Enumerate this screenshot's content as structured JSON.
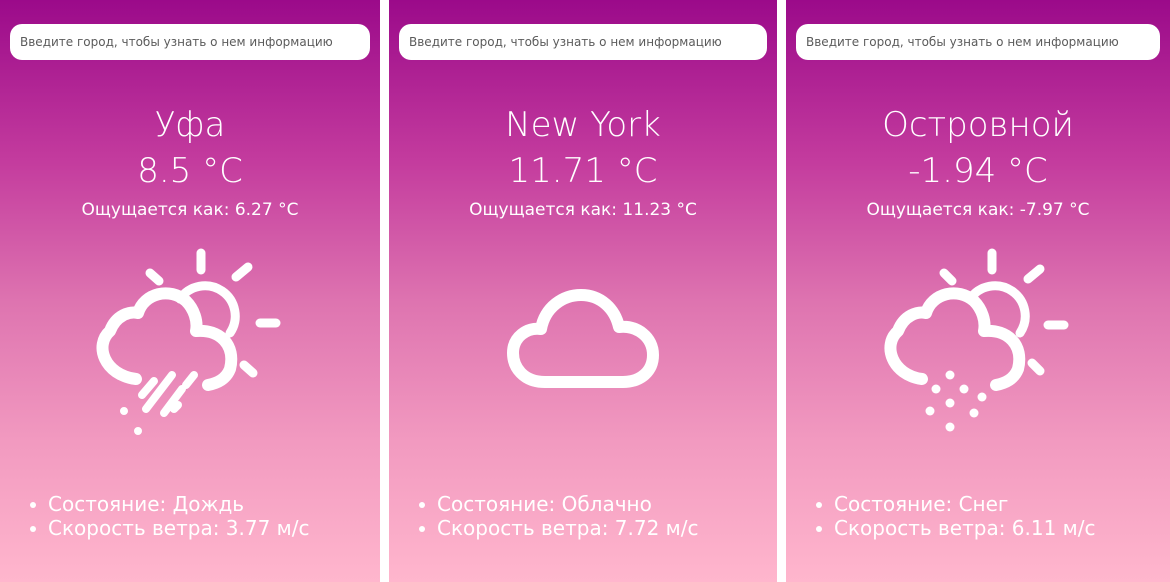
{
  "cards": [
    {
      "search_placeholder": "Введите город, чтобы узнать о нем информацию",
      "city": "Уфа",
      "temperature": "8.5 °C",
      "feels_like": "Ощущается как: 6.27 °C",
      "icon": "rain-cloud-sun-icon",
      "details": [
        "Состояние: Дождь",
        "Скорость ветра: 3.77 м/с"
      ]
    },
    {
      "search_placeholder": "Введите город, чтобы узнать о нем информацию",
      "city": "New York",
      "temperature": "11.71 °C",
      "feels_like": "Ощущается как: 11.23 °C",
      "icon": "cloud-icon",
      "details": [
        "Состояние: Облачно",
        "Скорость ветра: 7.72 м/с"
      ]
    },
    {
      "search_placeholder": "Введите город, чтобы узнать о нем информацию",
      "city": "Островной",
      "temperature": "-1.94 °C",
      "feels_like": "Ощущается как: -7.97 °C",
      "icon": "snow-cloud-sun-icon",
      "details": [
        "Состояние: Снег",
        "Скорость ветра: 6.11 м/с"
      ]
    }
  ],
  "colors": {
    "gradient_top": "#9b0a8a",
    "gradient_bottom": "#ffb6cd",
    "text": "#ffffff",
    "input_bg": "#ffffff"
  }
}
